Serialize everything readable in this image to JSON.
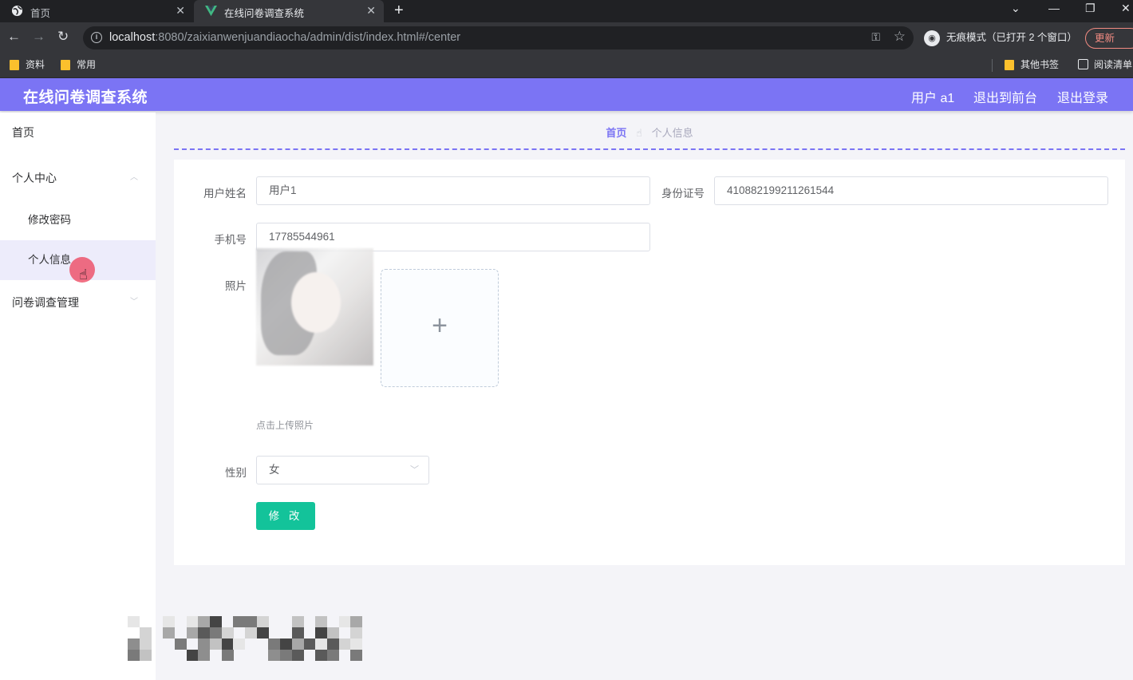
{
  "browser": {
    "tabs": [
      {
        "title": "首页",
        "active": false
      },
      {
        "title": "在线问卷调查系统",
        "active": true
      }
    ],
    "url_host": "localhost",
    "url_rest": ":8080/zaixianwenjuandiaocha/admin/dist/index.html#/center",
    "incognito_label": "无痕模式（已打开 2 个窗口）",
    "update_label": "更新",
    "bookmarks": [
      "资料",
      "常用"
    ],
    "other_bookmarks": "其他书签",
    "reading_list": "阅读清单"
  },
  "header": {
    "title": "在线问卷调查系统",
    "user": "用户 a1",
    "back_to_front": "退出到前台",
    "logout": "退出登录",
    "color": "#7b74f4"
  },
  "sidebar": {
    "items": [
      {
        "label": "首页"
      },
      {
        "label": "个人中心",
        "expanded": true
      },
      {
        "label": "修改密码"
      },
      {
        "label": "个人信息",
        "active": true
      },
      {
        "label": "问卷调查管理",
        "expanded": false
      }
    ]
  },
  "breadcrumb": {
    "home": "首页",
    "current": "个人信息"
  },
  "form": {
    "name_label": "用户姓名",
    "name_value": "用户1",
    "id_label": "身份证号",
    "id_value": "410882199211261544",
    "phone_label": "手机号",
    "phone_value": "17785544961",
    "photo_label": "照片",
    "upload_hint": "点击上传照片",
    "gender_label": "性别",
    "gender_value": "女",
    "submit": "修 改",
    "submit_color": "#13c39a"
  }
}
